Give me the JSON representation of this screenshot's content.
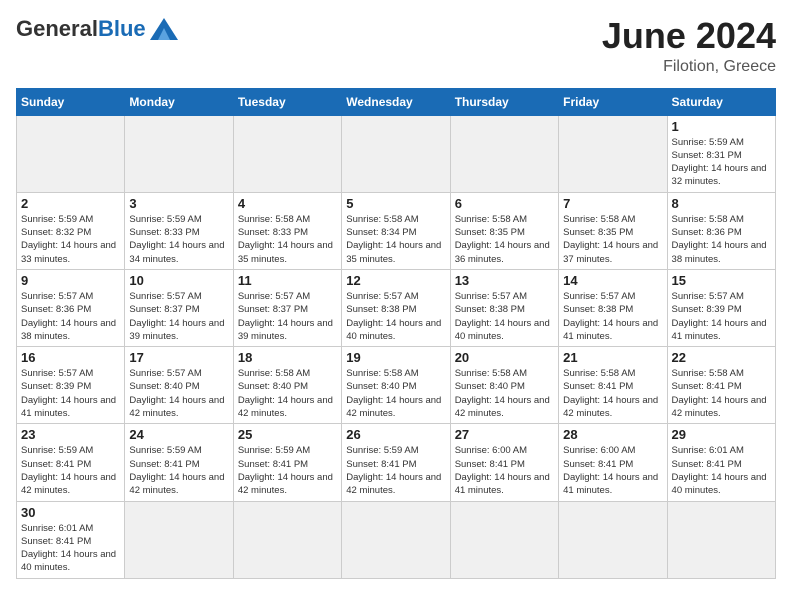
{
  "logo": {
    "general": "General",
    "blue": "Blue"
  },
  "title": "June 2024",
  "location": "Filotion, Greece",
  "days_of_week": [
    "Sunday",
    "Monday",
    "Tuesday",
    "Wednesday",
    "Thursday",
    "Friday",
    "Saturday"
  ],
  "weeks": [
    [
      {
        "day": "",
        "info": ""
      },
      {
        "day": "",
        "info": ""
      },
      {
        "day": "",
        "info": ""
      },
      {
        "day": "",
        "info": ""
      },
      {
        "day": "",
        "info": ""
      },
      {
        "day": "",
        "info": ""
      },
      {
        "day": "1",
        "info": "Sunrise: 5:59 AM\nSunset: 8:31 PM\nDaylight: 14 hours and 32 minutes."
      }
    ],
    [
      {
        "day": "2",
        "info": "Sunrise: 5:59 AM\nSunset: 8:32 PM\nDaylight: 14 hours and 33 minutes."
      },
      {
        "day": "3",
        "info": "Sunrise: 5:59 AM\nSunset: 8:33 PM\nDaylight: 14 hours and 34 minutes."
      },
      {
        "day": "4",
        "info": "Sunrise: 5:58 AM\nSunset: 8:33 PM\nDaylight: 14 hours and 35 minutes."
      },
      {
        "day": "5",
        "info": "Sunrise: 5:58 AM\nSunset: 8:34 PM\nDaylight: 14 hours and 35 minutes."
      },
      {
        "day": "6",
        "info": "Sunrise: 5:58 AM\nSunset: 8:35 PM\nDaylight: 14 hours and 36 minutes."
      },
      {
        "day": "7",
        "info": "Sunrise: 5:58 AM\nSunset: 8:35 PM\nDaylight: 14 hours and 37 minutes."
      },
      {
        "day": "8",
        "info": "Sunrise: 5:58 AM\nSunset: 8:36 PM\nDaylight: 14 hours and 38 minutes."
      }
    ],
    [
      {
        "day": "9",
        "info": "Sunrise: 5:57 AM\nSunset: 8:36 PM\nDaylight: 14 hours and 38 minutes."
      },
      {
        "day": "10",
        "info": "Sunrise: 5:57 AM\nSunset: 8:37 PM\nDaylight: 14 hours and 39 minutes."
      },
      {
        "day": "11",
        "info": "Sunrise: 5:57 AM\nSunset: 8:37 PM\nDaylight: 14 hours and 39 minutes."
      },
      {
        "day": "12",
        "info": "Sunrise: 5:57 AM\nSunset: 8:38 PM\nDaylight: 14 hours and 40 minutes."
      },
      {
        "day": "13",
        "info": "Sunrise: 5:57 AM\nSunset: 8:38 PM\nDaylight: 14 hours and 40 minutes."
      },
      {
        "day": "14",
        "info": "Sunrise: 5:57 AM\nSunset: 8:38 PM\nDaylight: 14 hours and 41 minutes."
      },
      {
        "day": "15",
        "info": "Sunrise: 5:57 AM\nSunset: 8:39 PM\nDaylight: 14 hours and 41 minutes."
      }
    ],
    [
      {
        "day": "16",
        "info": "Sunrise: 5:57 AM\nSunset: 8:39 PM\nDaylight: 14 hours and 41 minutes."
      },
      {
        "day": "17",
        "info": "Sunrise: 5:57 AM\nSunset: 8:40 PM\nDaylight: 14 hours and 42 minutes."
      },
      {
        "day": "18",
        "info": "Sunrise: 5:58 AM\nSunset: 8:40 PM\nDaylight: 14 hours and 42 minutes."
      },
      {
        "day": "19",
        "info": "Sunrise: 5:58 AM\nSunset: 8:40 PM\nDaylight: 14 hours and 42 minutes."
      },
      {
        "day": "20",
        "info": "Sunrise: 5:58 AM\nSunset: 8:40 PM\nDaylight: 14 hours and 42 minutes."
      },
      {
        "day": "21",
        "info": "Sunrise: 5:58 AM\nSunset: 8:41 PM\nDaylight: 14 hours and 42 minutes."
      },
      {
        "day": "22",
        "info": "Sunrise: 5:58 AM\nSunset: 8:41 PM\nDaylight: 14 hours and 42 minutes."
      }
    ],
    [
      {
        "day": "23",
        "info": "Sunrise: 5:59 AM\nSunset: 8:41 PM\nDaylight: 14 hours and 42 minutes."
      },
      {
        "day": "24",
        "info": "Sunrise: 5:59 AM\nSunset: 8:41 PM\nDaylight: 14 hours and 42 minutes."
      },
      {
        "day": "25",
        "info": "Sunrise: 5:59 AM\nSunset: 8:41 PM\nDaylight: 14 hours and 42 minutes."
      },
      {
        "day": "26",
        "info": "Sunrise: 5:59 AM\nSunset: 8:41 PM\nDaylight: 14 hours and 42 minutes."
      },
      {
        "day": "27",
        "info": "Sunrise: 6:00 AM\nSunset: 8:41 PM\nDaylight: 14 hours and 41 minutes."
      },
      {
        "day": "28",
        "info": "Sunrise: 6:00 AM\nSunset: 8:41 PM\nDaylight: 14 hours and 41 minutes."
      },
      {
        "day": "29",
        "info": "Sunrise: 6:01 AM\nSunset: 8:41 PM\nDaylight: 14 hours and 40 minutes."
      }
    ],
    [
      {
        "day": "30",
        "info": "Sunrise: 6:01 AM\nSunset: 8:41 PM\nDaylight: 14 hours and 40 minutes."
      },
      {
        "day": "",
        "info": ""
      },
      {
        "day": "",
        "info": ""
      },
      {
        "day": "",
        "info": ""
      },
      {
        "day": "",
        "info": ""
      },
      {
        "day": "",
        "info": ""
      },
      {
        "day": "",
        "info": ""
      }
    ]
  ]
}
